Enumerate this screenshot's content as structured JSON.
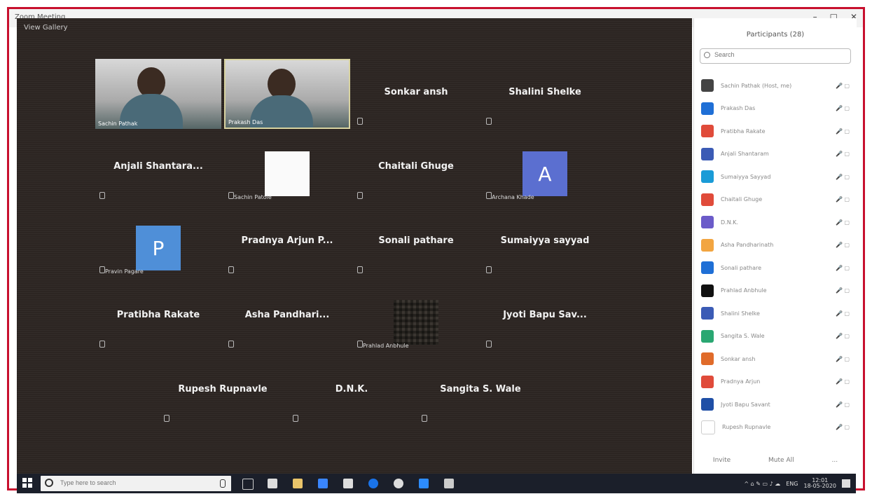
{
  "window": {
    "title": "Zoom Meeting",
    "minimize": "–",
    "maximize": "□",
    "close": "✕"
  },
  "stage": {
    "label": "View Gallery"
  },
  "tiles": {
    "video1": "Sachin Pathak",
    "video2": "Prakash Das",
    "sonkar": "Sonkar ansh",
    "shalini": "Shalini Shelke",
    "anjali": "Anjali Shantara...",
    "whitebox_name": "Sachin Patole",
    "chaitali": "Chaitali Ghuge",
    "a_name": "Archana Khade",
    "a_letter": "A",
    "p_letter": "P",
    "p_name": "Pravin Pagare",
    "pradnya": "Pradnya Arjun P...",
    "sonali": "Sonali pathare",
    "sumaiyya": "Sumaiyya sayyad",
    "pratibha": "Pratibha Rakate",
    "asha": "Asha Pandhari...",
    "qr_name": "Prahlad Anbhule",
    "jyoti": "Jyoti Bapu Sav...",
    "rupesh": "Rupesh Rupnavle",
    "dnk": "D.N.K.",
    "sangita": "Sangita S. Wale"
  },
  "panel": {
    "title": "Participants (28)",
    "search_placeholder": "Search",
    "participants": [
      {
        "name": "Sachin Pathak (Host, me)",
        "color": "#444444",
        "icons": "🎤 ▢"
      },
      {
        "name": "Prakash Das",
        "color": "#1f6fd6",
        "icons": "🎤 ▢"
      },
      {
        "name": "Pratibha Rakate",
        "color": "#e04b3a",
        "icons": "🎤 ▢"
      },
      {
        "name": "Anjali Shantaram",
        "color": "#3b5bb5",
        "icons": "🎤 ▢"
      },
      {
        "name": "Sumaiyya Sayyad",
        "color": "#1a9bd7",
        "icons": "🎤 ▢"
      },
      {
        "name": "Chaitali Ghuge",
        "color": "#e04b3a",
        "icons": "🎤 ▢"
      },
      {
        "name": "D.N.K.",
        "color": "#6b5bc9",
        "icons": "🎤 ▢"
      },
      {
        "name": "Asha Pandharinath",
        "color": "#f2a541",
        "icons": "🎤 ▢"
      },
      {
        "name": "Sonali pathare",
        "color": "#1f6fd6",
        "icons": "🎤 ▢"
      },
      {
        "name": "Prahlad Anbhule",
        "color": "#111111",
        "icons": "🎤 ▢"
      },
      {
        "name": "Shalini Shelke",
        "color": "#3b5bb5",
        "icons": "🎤 ▢"
      },
      {
        "name": "Sangita S. Wale",
        "color": "#2aa772",
        "icons": "🎤 ▢"
      },
      {
        "name": "Sonkar ansh",
        "color": "#e06b2a",
        "icons": "🎤 ▢"
      },
      {
        "name": "Pradnya Arjun",
        "color": "#e04b3a",
        "icons": "🎤 ▢"
      },
      {
        "name": "Jyoti Bapu Savant",
        "color": "#1f4fa6",
        "icons": "🎤 ▢"
      },
      {
        "name": "Rupesh Rupnavle",
        "color": "#ffffff",
        "icons": "🎤 ▢"
      }
    ],
    "invite": "Invite",
    "mute_all": "Mute All",
    "more": "..."
  },
  "taskbar": {
    "search_placeholder": "Type here to search",
    "time": "12:01",
    "date": "18-05-2020",
    "lang": "ENG",
    "tray_icons": "^ ⌂ ✎ ▭ ♪ ☁"
  }
}
